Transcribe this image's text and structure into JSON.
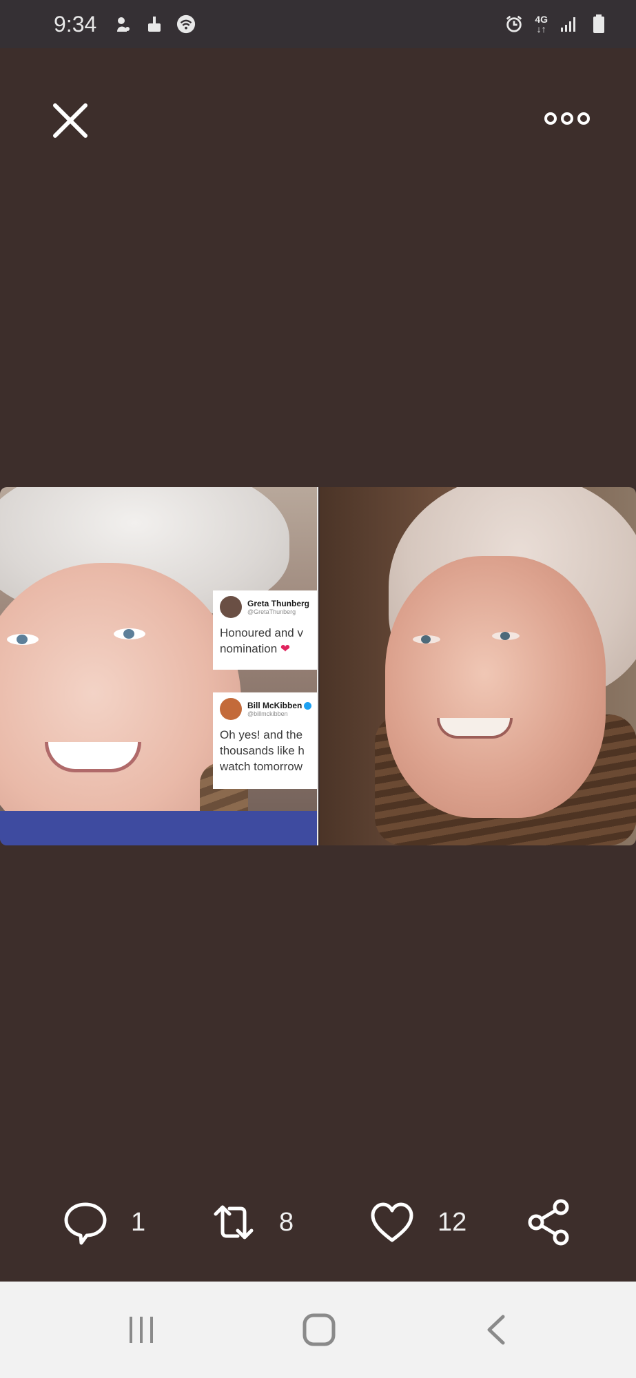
{
  "status_bar": {
    "time": "9:34",
    "left_icons": [
      "cat-notification-icon",
      "broom-icon",
      "wifi-icon"
    ],
    "network": "4G",
    "right_icons": [
      "alarm-icon",
      "network-4g-icon",
      "signal-icon",
      "battery-icon"
    ]
  },
  "top_bar": {
    "close_icon": "close-icon",
    "more_icon": "more-options-icon"
  },
  "media": {
    "tweet_cards": [
      {
        "name": "Greta Thunberg",
        "handle": "@GretaThunberg",
        "line1": "Honoured and v",
        "line2": "nomination",
        "verified": false
      },
      {
        "name": "Bill McKibben",
        "handle": "@billmckibben",
        "line1": "Oh yes! and the",
        "line2": "thousands like h",
        "line3": "watch tomorrow",
        "verified": true
      }
    ]
  },
  "actions": {
    "reply_count": "1",
    "retweet_count": "8",
    "like_count": "12",
    "share_icon": "share-icon"
  },
  "nav_bar": {
    "recents_icon": "recents-icon",
    "home_icon": "home-icon",
    "back_icon": "back-icon"
  },
  "colors": {
    "background": "#3d2e2b",
    "status_bar": "#353034",
    "nav_bar": "#f2f2f2"
  }
}
